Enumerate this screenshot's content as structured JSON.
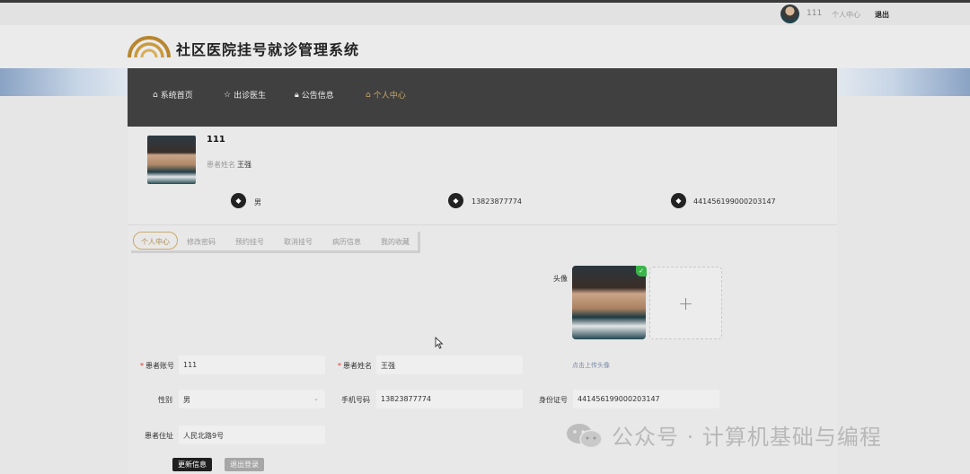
{
  "topbar": {
    "username": "111",
    "user_center": "个人中心",
    "logout": "退出"
  },
  "header": {
    "site_title": "社区医院挂号就诊管理系统"
  },
  "nav": [
    {
      "label": "系统首页",
      "icon": "home-icon"
    },
    {
      "label": "出诊医生",
      "icon": "star-icon"
    },
    {
      "label": "公告信息",
      "icon": "lock-icon"
    },
    {
      "label": "个人中心",
      "icon": "home-icon",
      "active": true
    }
  ],
  "profile": {
    "name": "111",
    "name_label": "患者姓名",
    "name_value": "王强",
    "gender": "男",
    "phone": "13823877774",
    "id_number": "441456199000203147"
  },
  "tabs": [
    {
      "label": "个人中心",
      "active": true
    },
    {
      "label": "修改密码"
    },
    {
      "label": "预约挂号"
    },
    {
      "label": "取消挂号"
    },
    {
      "label": "病历信息"
    },
    {
      "label": "我的收藏"
    }
  ],
  "form": {
    "avatar_label": "头像",
    "upload_hint": "点击上传头像",
    "account_label": "患者账号",
    "account_value": "111",
    "patient_name_label": "患者姓名",
    "patient_name_value": "王强",
    "gender_label": "性别",
    "gender_value": "男",
    "phone_label": "手机号码",
    "phone_value": "13823877774",
    "id_label": "身份证号",
    "id_value": "441456199000203147",
    "address_label": "患者住址",
    "address_value": "人民北路9号",
    "update_button": "更新信息",
    "logout_button": "退出登录"
  },
  "watermark": {
    "text": "公众号 · 计算机基础与编程"
  },
  "colors": {
    "accent": "#c9a96a",
    "nav_bg": "#404040",
    "required": "#dd3333"
  }
}
